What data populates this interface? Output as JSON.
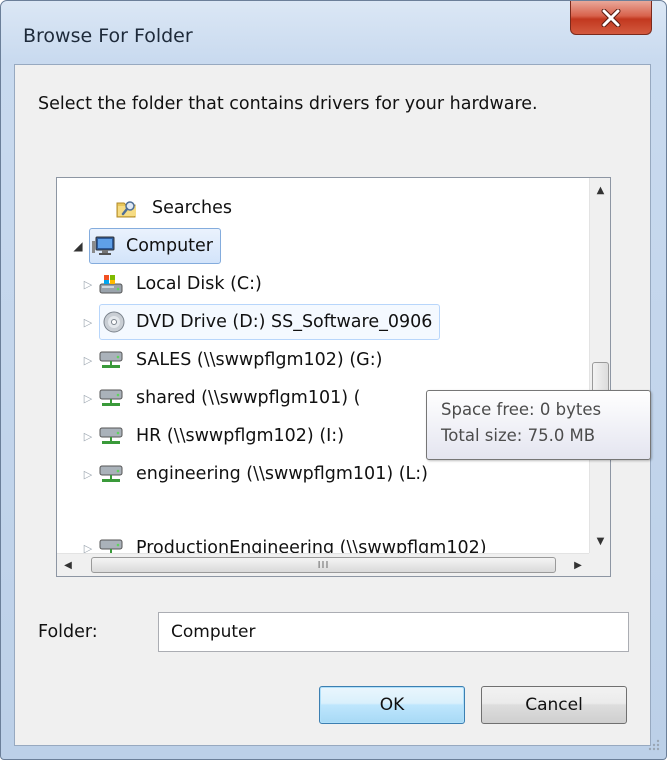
{
  "window": {
    "title": "Browse For Folder",
    "close_glyph": "X"
  },
  "instruction": "Select the folder that contains drivers for your hardware.",
  "tree": {
    "nodes": [
      {
        "label": "Searches",
        "icon": "searches-folder-icon",
        "expander": "none"
      },
      {
        "label": "Computer",
        "icon": "computer-icon",
        "expander": "expanded",
        "selected": true
      },
      {
        "label": "Local Disk (C:)",
        "icon": "local-disk-icon",
        "expander": "collapsed"
      },
      {
        "label": "DVD Drive (D:) SS_Software_0906",
        "icon": "dvd-drive-icon",
        "expander": "collapsed",
        "hovered": true
      },
      {
        "label": "SALES (\\\\swwpflgm102) (G:)",
        "icon": "network-drive-icon",
        "expander": "collapsed"
      },
      {
        "label": "shared (\\\\swwpflgm101) (",
        "icon": "network-drive-icon",
        "expander": "collapsed"
      },
      {
        "label": "HR (\\\\swwpflgm102) (I:)",
        "icon": "network-drive-icon",
        "expander": "collapsed"
      },
      {
        "label": "engineering (\\\\swwpflgm101) (L:)",
        "icon": "network-drive-icon",
        "expander": "collapsed"
      },
      {
        "label": "ProductionEngineering (\\\\swwpflgm102)",
        "icon": "network-drive-icon",
        "expander": "collapsed"
      }
    ],
    "hscroll_thumb_grip": "III"
  },
  "tooltip": {
    "line1": "Space free: 0 bytes",
    "line2": "Total size: 75.0 MB"
  },
  "folder": {
    "label": "Folder:",
    "value": "Computer"
  },
  "buttons": {
    "ok": "OK",
    "cancel": "Cancel"
  },
  "colors": {
    "window_frame": "#c9daef",
    "close_button": "#c2381f",
    "selection": "#d3e4fa",
    "ok_button": "#bee6fd"
  }
}
